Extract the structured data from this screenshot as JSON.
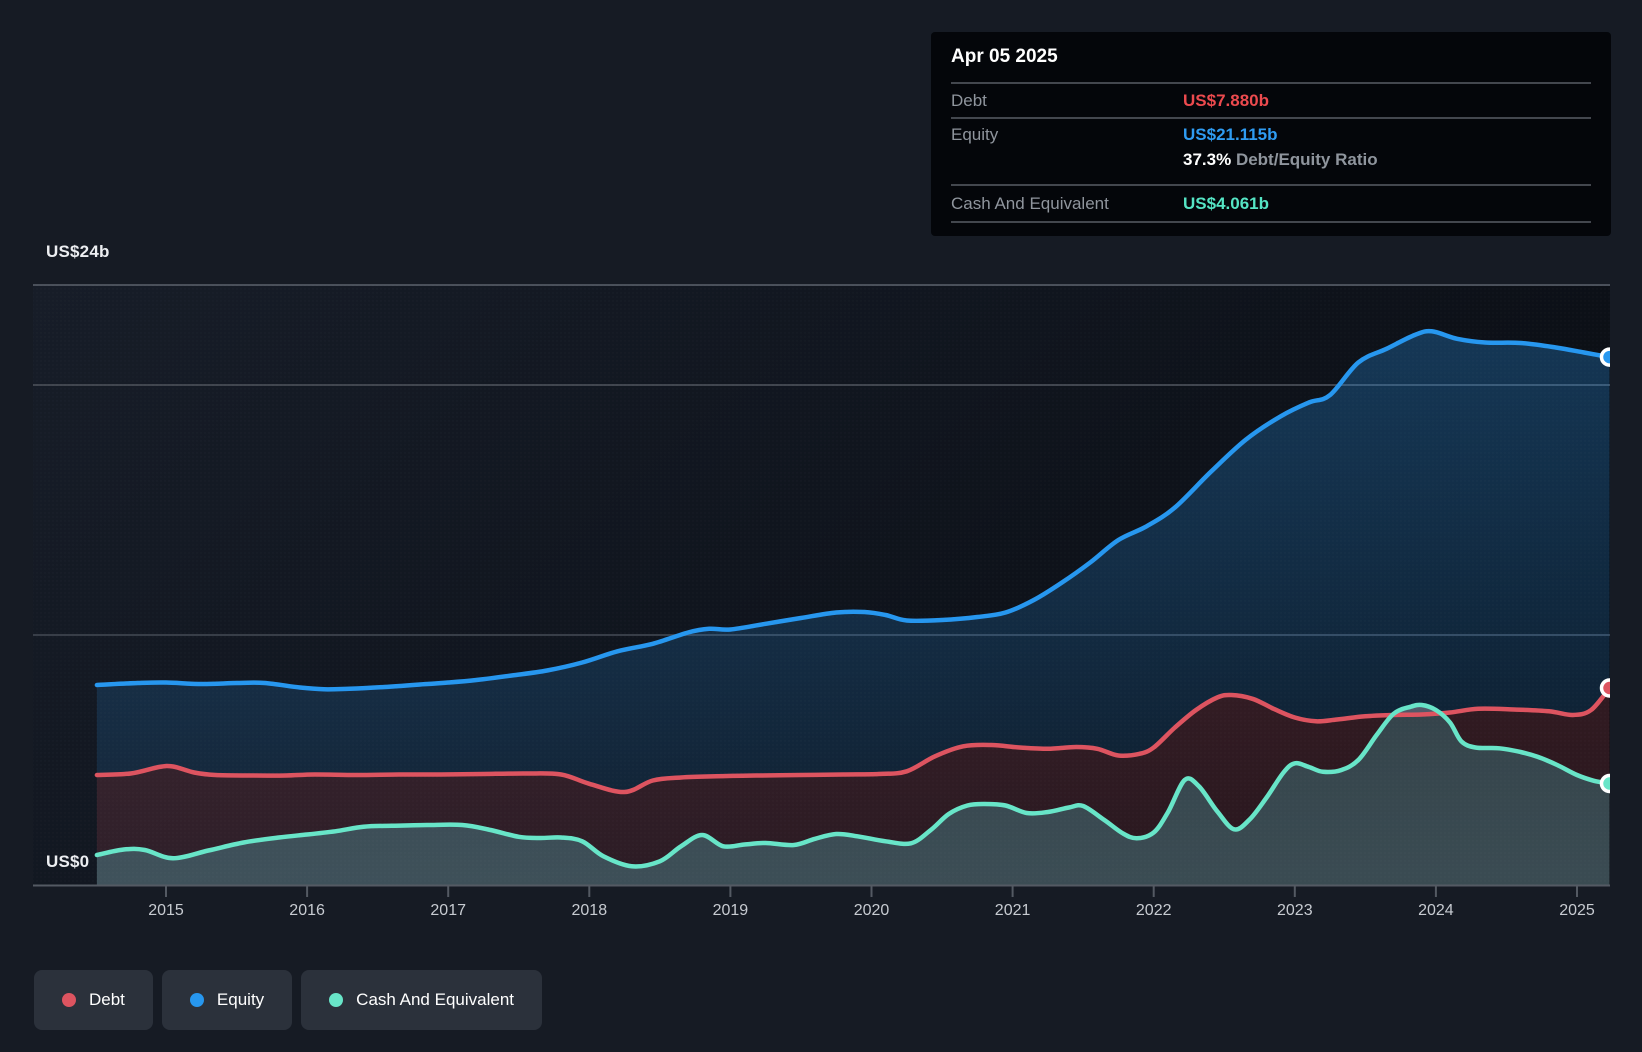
{
  "colors": {
    "background": "#161b24",
    "tooltip-bg": "#04060a",
    "legend-bg": "#2b313b",
    "debt": "#dd5460",
    "equity": "#2797ef",
    "cash": "#68e5c8",
    "debt-value-text": "#ec4a4e",
    "equity-value-text": "#2f9cf2",
    "cash-value-text": "#55e4c4",
    "axis": "#545a63",
    "grid-major": "#4a505a",
    "grid-minor": "#3c424c",
    "tick-label": "#c7cbd1",
    "muted-label": "#8f959d",
    "white-label": "#eceef1",
    "separator": "#43474e"
  },
  "tooltip": {
    "date": "Apr 05 2025",
    "debt_label": "Debt",
    "debt_value": "US$7.880b",
    "equity_label": "Equity",
    "equity_value": "US$21.115b",
    "ratio_value": "37.3%",
    "ratio_label": "Debt/Equity Ratio",
    "cash_label": "Cash And Equivalent",
    "cash_value": "US$4.061b"
  },
  "y_axis": {
    "top_label": "US$24b",
    "bottom_label": "US$0"
  },
  "legend": {
    "debt": "Debt",
    "equity": "Equity",
    "cash": "Cash And Equivalent"
  },
  "chart_data": {
    "type": "area",
    "x_domain": [
      2014.51,
      2025.23
    ],
    "ylim": [
      0,
      24
    ],
    "y_unit": "US$ billions",
    "x_ticks": [
      "2015",
      "2016",
      "2017",
      "2018",
      "2019",
      "2020",
      "2021",
      "2022",
      "2023",
      "2024",
      "2025"
    ],
    "x_tick_years": [
      2015,
      2016,
      2017,
      2018,
      2019,
      2020,
      2021,
      2022,
      2023,
      2024,
      2025
    ],
    "y_gridlines": [
      {
        "value": 24,
        "label": "US$24b",
        "color": "#4a505a",
        "width": 2
      },
      {
        "value": 20,
        "label": "",
        "color": "#40454e",
        "width": 2
      },
      {
        "value": 10,
        "label": "",
        "color": "#383e48",
        "width": 2
      },
      {
        "value": 0,
        "label": "US$0",
        "color": "#545a63",
        "width": 2
      }
    ],
    "legend_position": "bottom-left",
    "series": [
      {
        "name": "Equity",
        "color": "#2797ef",
        "fill_top": "rgba(41,151,239,0.30)",
        "fill_bottom": "rgba(41,151,239,0.10)",
        "end_value_label": "US$21.115b",
        "x": [
          2014.51,
          2014.8,
          2015.0,
          2015.25,
          2015.5,
          2015.7,
          2015.95,
          2016.12,
          2016.3,
          2016.55,
          2016.8,
          2017.0,
          2017.2,
          2017.45,
          2017.7,
          2017.95,
          2018.2,
          2018.45,
          2018.7,
          2018.85,
          2019.0,
          2019.25,
          2019.5,
          2019.75,
          2019.95,
          2020.1,
          2020.25,
          2020.5,
          2020.75,
          2020.95,
          2021.15,
          2021.35,
          2021.55,
          2021.75,
          2021.95,
          2022.15,
          2022.4,
          2022.65,
          2022.9,
          2023.1,
          2023.25,
          2023.45,
          2023.65,
          2023.85,
          2023.97,
          2024.15,
          2024.35,
          2024.6,
          2024.85,
          2025.05,
          2025.23
        ],
        "values": [
          8.0,
          8.08,
          8.1,
          8.04,
          8.08,
          8.08,
          7.9,
          7.83,
          7.85,
          7.92,
          8.02,
          8.1,
          8.2,
          8.38,
          8.58,
          8.9,
          9.35,
          9.65,
          10.1,
          10.25,
          10.22,
          10.45,
          10.68,
          10.9,
          10.92,
          10.8,
          10.58,
          10.6,
          10.72,
          10.9,
          11.4,
          12.1,
          12.9,
          13.8,
          14.35,
          15.1,
          16.5,
          17.8,
          18.75,
          19.3,
          19.6,
          20.9,
          21.45,
          22.0,
          22.15,
          21.85,
          21.7,
          21.68,
          21.5,
          21.3,
          21.115
        ]
      },
      {
        "name": "Debt",
        "color": "#dd5460",
        "fill_top": "rgba(221,84,96,0.28)",
        "fill_bottom": "rgba(221,84,96,0.14)",
        "end_value_label": "US$7.880b",
        "x": [
          2014.51,
          2014.75,
          2014.95,
          2015.05,
          2015.2,
          2015.35,
          2015.6,
          2015.85,
          2016.05,
          2016.35,
          2016.65,
          2016.95,
          2017.25,
          2017.55,
          2017.8,
          2018.0,
          2018.25,
          2018.45,
          2018.65,
          2018.9,
          2019.2,
          2019.5,
          2019.8,
          2020.05,
          2020.25,
          2020.45,
          2020.65,
          2020.85,
          2021.05,
          2021.25,
          2021.45,
          2021.6,
          2021.75,
          2021.9,
          2022.0,
          2022.15,
          2022.3,
          2022.45,
          2022.55,
          2022.7,
          2022.85,
          2023.0,
          2023.15,
          2023.3,
          2023.5,
          2023.7,
          2023.9,
          2024.1,
          2024.3,
          2024.55,
          2024.8,
          2024.97,
          2025.1,
          2025.23
        ],
        "values": [
          4.4,
          4.46,
          4.72,
          4.74,
          4.5,
          4.4,
          4.38,
          4.38,
          4.42,
          4.4,
          4.42,
          4.42,
          4.44,
          4.46,
          4.42,
          4.05,
          3.72,
          4.18,
          4.3,
          4.35,
          4.38,
          4.4,
          4.42,
          4.44,
          4.55,
          5.15,
          5.55,
          5.6,
          5.5,
          5.45,
          5.52,
          5.45,
          5.18,
          5.25,
          5.5,
          6.3,
          7.0,
          7.5,
          7.6,
          7.45,
          7.05,
          6.7,
          6.55,
          6.62,
          6.75,
          6.8,
          6.82,
          6.9,
          7.05,
          7.02,
          6.95,
          6.8,
          7.0,
          7.88
        ]
      },
      {
        "name": "Cash And Equivalent",
        "color": "#68e5c8",
        "fill_top": "rgba(152,196,205,0.20)",
        "fill_bottom": "rgba(152,196,205,0.34)",
        "end_value_label": "US$4.061b",
        "x": [
          2014.51,
          2014.7,
          2014.85,
          2015.05,
          2015.3,
          2015.55,
          2015.8,
          2016.0,
          2016.2,
          2016.4,
          2016.6,
          2016.85,
          2017.1,
          2017.3,
          2017.5,
          2017.65,
          2017.8,
          2017.95,
          2018.1,
          2018.3,
          2018.5,
          2018.65,
          2018.8,
          2018.95,
          2019.1,
          2019.25,
          2019.45,
          2019.6,
          2019.75,
          2019.9,
          2020.1,
          2020.28,
          2020.42,
          2020.55,
          2020.68,
          2020.8,
          2020.95,
          2021.1,
          2021.25,
          2021.4,
          2021.5,
          2021.65,
          2021.78,
          2021.88,
          2022.0,
          2022.1,
          2022.22,
          2022.32,
          2022.45,
          2022.57,
          2022.68,
          2022.8,
          2022.92,
          2023.0,
          2023.1,
          2023.2,
          2023.33,
          2023.45,
          2023.58,
          2023.7,
          2023.82,
          2023.9,
          2024.0,
          2024.1,
          2024.18,
          2024.28,
          2024.45,
          2024.6,
          2024.72,
          2024.86,
          2025.0,
          2025.12,
          2025.23
        ],
        "values": [
          1.2,
          1.42,
          1.4,
          1.07,
          1.38,
          1.7,
          1.9,
          2.02,
          2.15,
          2.33,
          2.37,
          2.4,
          2.4,
          2.2,
          1.93,
          1.88,
          1.9,
          1.75,
          1.15,
          0.75,
          0.95,
          1.55,
          2.0,
          1.55,
          1.62,
          1.68,
          1.6,
          1.85,
          2.04,
          1.95,
          1.75,
          1.67,
          2.2,
          2.85,
          3.18,
          3.24,
          3.18,
          2.88,
          2.92,
          3.1,
          3.16,
          2.6,
          2.07,
          1.87,
          2.1,
          2.9,
          4.2,
          3.95,
          2.95,
          2.23,
          2.62,
          3.5,
          4.5,
          4.87,
          4.72,
          4.53,
          4.6,
          5.0,
          6.0,
          6.85,
          7.13,
          7.2,
          7.0,
          6.5,
          5.75,
          5.5,
          5.47,
          5.32,
          5.13,
          4.8,
          4.4,
          4.17,
          4.061
        ]
      }
    ]
  }
}
